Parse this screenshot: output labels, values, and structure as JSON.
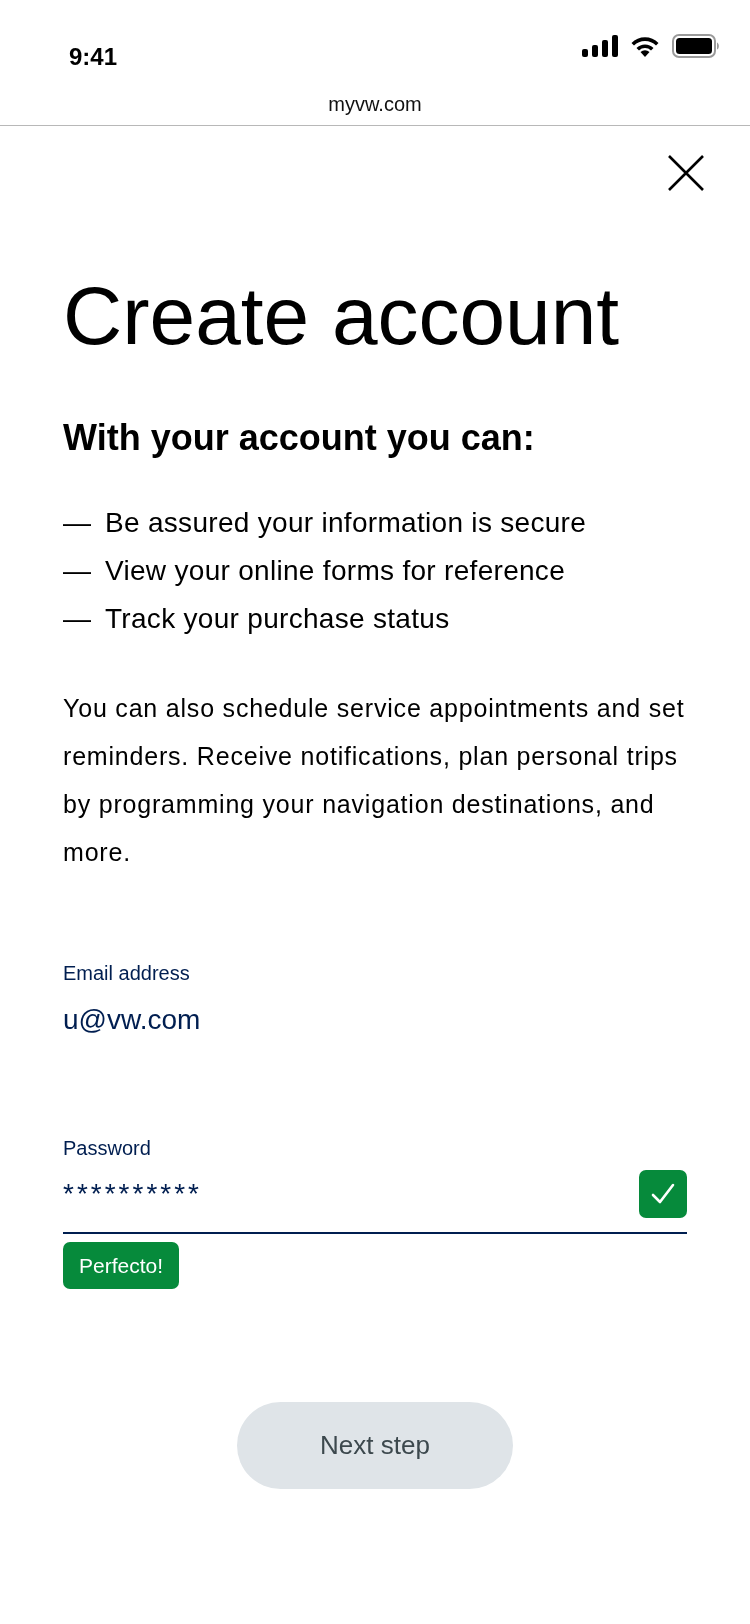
{
  "status_bar": {
    "time": "9:41"
  },
  "browser": {
    "url": "myvw.com"
  },
  "title": "Create account",
  "subtitle": "With your account you can:",
  "benefits": [
    {
      "marker": "—",
      "text": "Be assured your information is secure"
    },
    {
      "marker": "—",
      "text": "View your online forms for reference"
    },
    {
      "marker": "—",
      "text": "Track your purchase status"
    }
  ],
  "description": "You can also schedule service appointments and set reminders. Receive notifications, plan personal trips by programming your navigation destinations, and more.",
  "fields": [
    {
      "kind": "email",
      "label": "Email address",
      "value": "u@vw.com"
    },
    {
      "kind": "password",
      "label": "Password",
      "value": "**********",
      "valid": true,
      "message": "Perfecto!"
    }
  ],
  "primary_button": {
    "label": "Next step",
    "disabled": true
  }
}
